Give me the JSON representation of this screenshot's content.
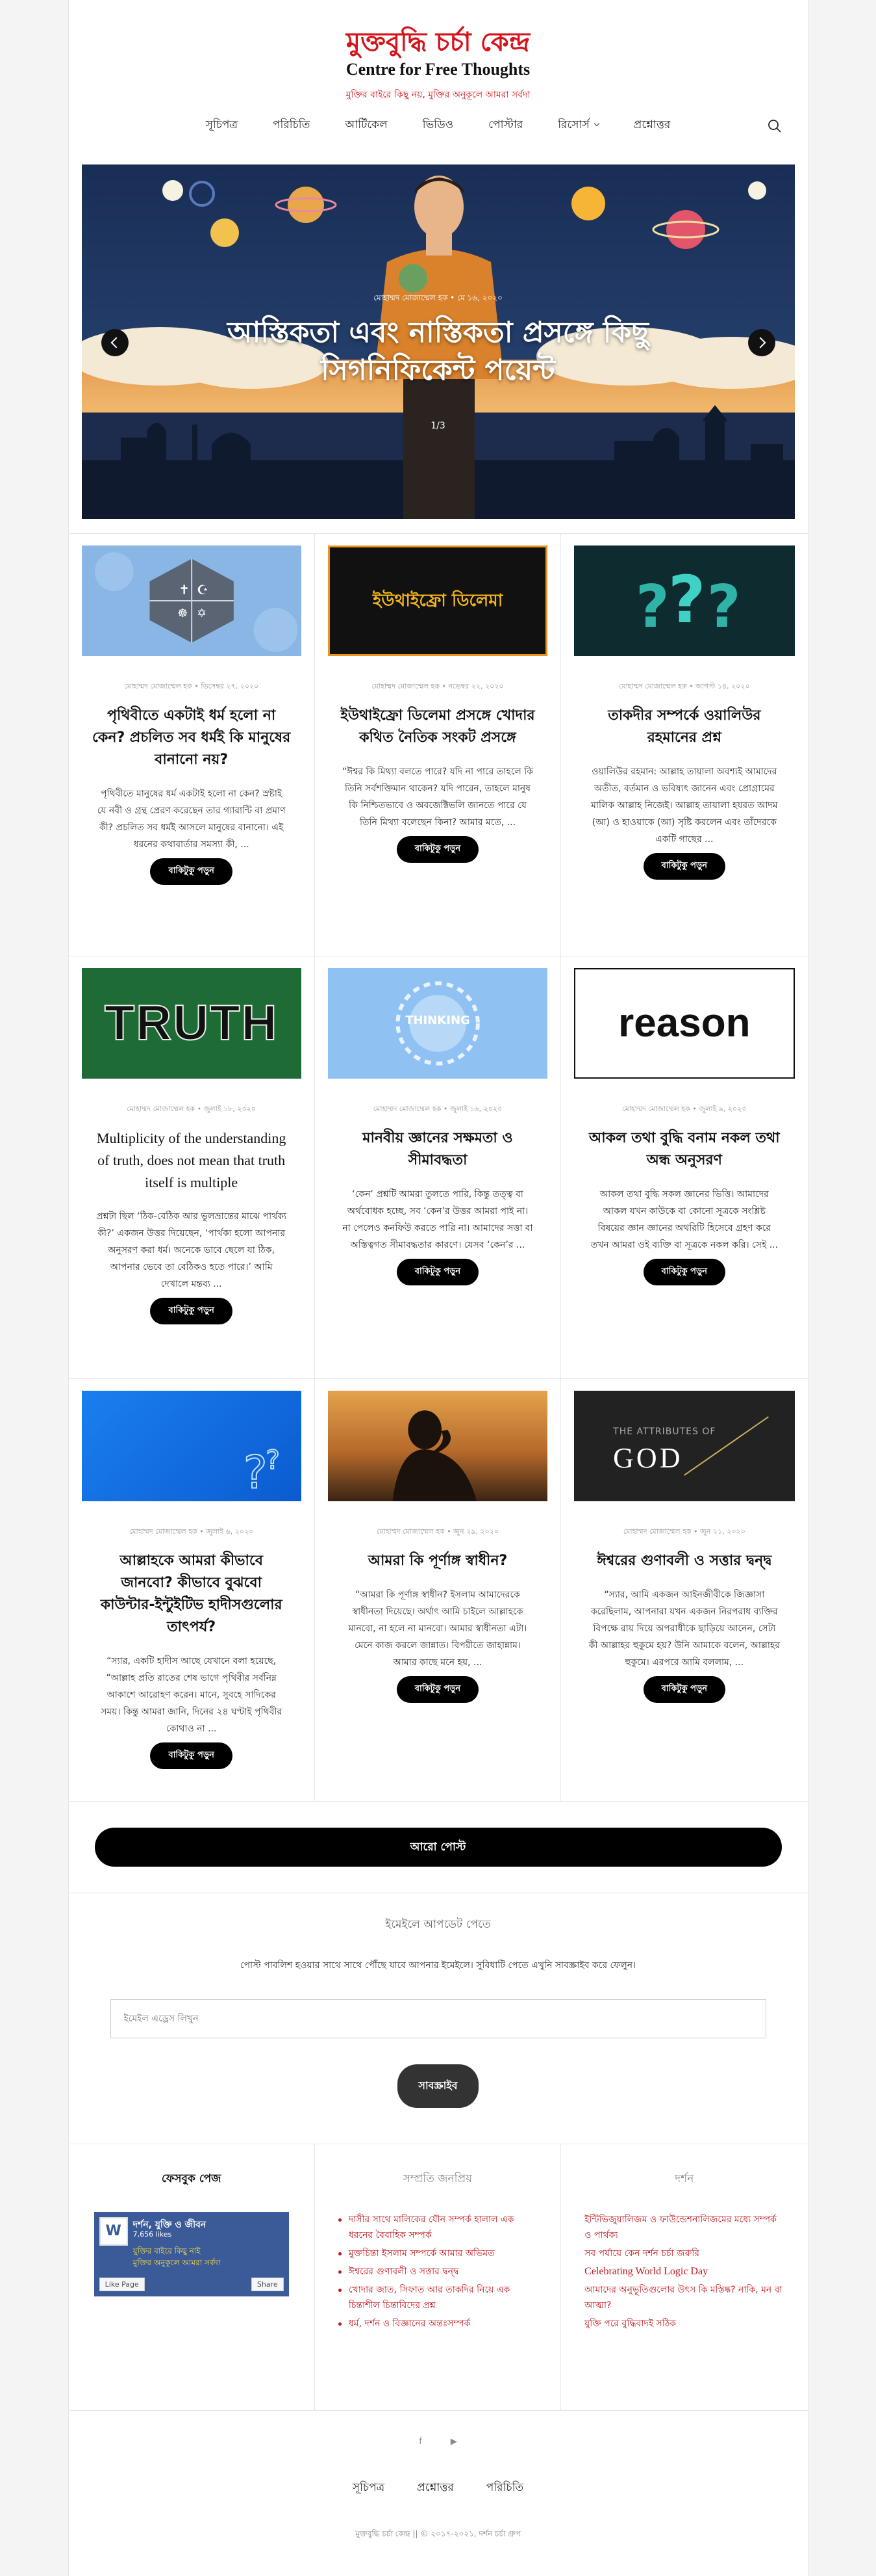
{
  "site": {
    "logo_bn": "মুক্তবুদ্ধি চর্চা কেন্দ্র",
    "logo_en": "Centre for Free Thoughts",
    "tagline": "মুক্তির বাইরে কিছু নয়, মুক্তির অনুকূলে আমরা সর্বদা"
  },
  "nav": [
    "সূচিপত্র",
    "পরিচিতি",
    "আর্টিকেল",
    "ভিডিও",
    "পোস্টার",
    "রিসোর্স",
    "প্রশ্নোত্তর"
  ],
  "slider": {
    "meta": "মোহাম্মদ মোজাম্মেল হক • মে ১৬, ২০২০",
    "title": "আস্তিকতা এবং নাস্তিকতা প্রসঙ্গে কিছু সিগনিফিকেন্ট পয়েন্ট",
    "count": "1/3"
  },
  "read_more": "বাকিটুকু পড়ুন",
  "posts": [
    {
      "meta": "মোহাম্মদ মোজাম্মেল হক • ডিসেম্বর ২৭, ২০২০",
      "title": "পৃথিবীতে একটাই ধর্ম হলো না কেন? প্রচলিত সব ধর্মই কি মানুষের বানানো নয়?",
      "excerpt": "পৃথিবীতে মানুষের ধর্ম একটাই হলো না কেন? স্রষ্টাই যে নবী ও গ্রন্থ প্রেরণ করেছেন তার গ্যারান্টি বা প্রমাণ কী? প্রচলিত সব ধর্মই আসলে মানুষের বানানো। এই ধরনের কথাবার্তার সমস্যা কী, ...",
      "thumb": "religions"
    },
    {
      "meta": "মোহাম্মদ মোজাম্মেল হক • নভেম্বর ২২, ২০২০",
      "title": "ইউথাইফ্রো ডিলেমা প্রসঙ্গে খোদার কথিত নৈতিক সংকট প্রসঙ্গে",
      "excerpt": "“ঈশ্বর কি মিথ্যা বলতে পারে? যদি না পারে তাহলে কি তিনি সর্বশক্তিমান থাকেন? যদি পারেন, তাহলে মানুষ কি নিশ্চিতভাবে ও অবজেক্টিভলি জানতে পারে যে তিনি মিথ্যা বলেছেন কিনা? আমার মতে, ...",
      "thumb": "dilemma",
      "thumb_text": "ইউথাইফ্রো ডিলেমা"
    },
    {
      "meta": "মোহাম্মদ মোজাম্মেল হক • আগস্ট ১৪, ২০২০",
      "title": "তাকদীর সম্পর্কে ওয়ালিউর রহমানের প্রশ্ন",
      "excerpt": "ওয়ালিউর রহমান: আল্লাহ তায়ালা অবশ্যই আমাদের অতীত, বর্তমান ও ভবিষ্যৎ জানেন এবং প্রোগ্রামের মালিক আল্লাহ নিজেই। আল্লাহ তায়ালা হযরত আদম (আ) ও হাওয়াকে (আ) সৃষ্টি করলেন এবং তাঁদেরকে একটি গাছের ...",
      "thumb": "question"
    },
    {
      "meta": "মোহাম্মদ মোজাম্মেল হক • জুলাই ১৮, ২০২০",
      "title": "Multiplicity of the understanding of truth, does not mean that truth itself is multiple",
      "excerpt": "প্রশ্নটা ছিল ‘ঠিক-বেঠিক আর ভুলভ্রান্তের মাঝে পার্থক্য কী?’ একজন উত্তর দিয়েছেন, ‘পার্থক্য হলো আপনার অনুসরণ করা ধর্ম। অনেকে ভাবে ছেলে যা ঠিক, আপনার ভেবে তা বেঠিকও হতে পারে।’ আমি দেখালে মন্তব্য ...",
      "thumb": "truth",
      "thumb_text": "TRUTH"
    },
    {
      "meta": "মোহাম্মদ মোজাম্মেল হক • জুলাই ১৬, ২০২০",
      "title": "মানবীয় জ্ঞানের সক্ষমতা ও সীমাবদ্ধতা",
      "excerpt": "‘কেন’ প্রশ্নটি আমরা তুলতে পারি, কিন্তু তত্ত্ব বা অর্থবোধক হচ্ছে, সব ‘কেন’র উত্তর আমরা পাই না। না পেলেও কনফিউ করতে পারি না। আমাদের সত্তা বা অস্তিত্বগত সীমাবদ্ধতার কারণে। যেসব ‘কেন’র ...",
      "thumb": "thinking",
      "thumb_text": "THINKING"
    },
    {
      "meta": "মোহাম্মদ মোজাম্মেল হক • জুলাই ৯, ২০২০",
      "title": "আকল তথা বুদ্ধি বনাম নকল তথা অন্ধ অনুসরণ",
      "excerpt": "আকল তথা বুদ্ধি সকল জ্ঞানের ভিত্তি। আমাদের আকল যখন কাউকে বা কোনো সূত্রকে সংশ্লিষ্ট বিষয়ের জ্ঞান জ্ঞানের অথরিটি হিসেবে গ্রহণ করে তখন আমরা ওই ব্যক্তি বা সূত্রকে নকল করি। সেই ...",
      "thumb": "reason",
      "thumb_text": "reason"
    },
    {
      "meta": "মোহাম্মদ মোজাম্মেল হক • জুলাই ৬, ২০২০",
      "title": "আল্লাহকে আমরা কীভাবে জানবো? কীভাবে বুঝবো কাউন্টার-ইন্টুইটিভ হাদীসগুলোর তাৎপর্য?",
      "excerpt": "“স্যার, একটি হাদীস আছে যেখানে বলা হয়েছে, “আল্লাহ প্রতি রাতের শেষ ভাগে পৃথিবীর সর্বনিম্ন আকাশে আরোহণ করেন। মানে, সুবহে সাদিকের সময়। কিন্তু আমরা জানি, দিনের ২৪ ঘণ্টাই পৃথিবীর কোথাও না ...",
      "thumb": "blueq"
    },
    {
      "meta": "মোহাম্মদ মোজাম্মেল হক • জুন ২৯, ২০২০",
      "title": "আমরা কি পূর্ণাঙ্গ স্বাধীন?",
      "excerpt": "“আমরা কি পূর্ণাঙ্গ স্বাধীন? ইসলাম আমাদেরকে স্বাধীনতা দিয়েছে। অর্থাৎ আমি চাইলে আল্লাহকে মানবো, না হলে না মানবো। আমার স্বাধীনতা এটা। মেনে কাজ করলে জান্নাত। বিপরীতে জাহান্নাম। আমার কাছে মনে হয়, ...",
      "thumb": "sunset"
    },
    {
      "meta": "মোহাম্মদ মোজাম্মেল হক • জুন ২১, ২০২০",
      "title": "ঈশ্বরের গুণাবলী ও সত্তার দ্বন্দ্ব",
      "excerpt": "“স্যার, আমি একজন আইনজীবীকে জিজ্ঞাসা করেছিলাম, আপনারা যখন একজন নিরপরাধ ব্যক্তির বিপক্ষে রায় দিয়ে অপরাধীকে ছাড়িয়ে আনেন, সেটা কী আল্লাহর হুকুমে হয়? উনি আমাকে বলেন, আল্লাহর হুকুমে। এরপরে আমি বললাম, ...",
      "thumb": "god",
      "thumb_text_small": "THE ATTRIBUTES OF",
      "thumb_text": "GOD"
    }
  ],
  "more_posts": "আরো পোস্ট",
  "subscribe": {
    "heading": "ইমেইলে আপডেট পেতে",
    "text": "পোস্ট পাবলিশ হওয়ার সাথে সাথে পৌঁছে যাবে আপনার ইমেইলে। সুবিধাটি পেতে এখুনি সাবস্ক্রাইব করে ফেলুন।",
    "placeholder": "ইমেইল এড্রেস লিখুন",
    "button": "সাবস্ক্রাইব"
  },
  "widgets": {
    "facebook": {
      "heading": "ফেসবুক পেজ",
      "page_name": "দর্শন, যুক্তি ও জীবন",
      "likes": "7,656 likes",
      "cover_text_1": "যুক্তির বাইরে কিছু নাই",
      "cover_text_2": "মুক্তির অনুকূলে আমরা সর্বদা",
      "like_btn": "Like Page",
      "share_btn": "Share"
    },
    "popular": {
      "heading": "সম্প্রতি জনপ্রিয়",
      "items": [
        "দাসীর সাথে মালিকের যৌন সম্পর্ক হালাল এক ধরনের বৈবাহিক সম্পর্ক",
        "মুক্তচিন্তা ইসলাম সম্পর্কে আমার অভিমত",
        "ঈশ্বরের গুণাবলী ও সত্তার দ্বন্দ্ব",
        "খোদার জাত, সিফাত আর তাকদির নিয়ে এক চিন্তাশীল চিন্তাবিদের প্রশ্ন",
        "ধর্ম, দর্শন ও বিজ্ঞানের অন্তঃসম্পর্ক"
      ]
    },
    "philosophy": {
      "heading": "দর্শন",
      "items": [
        "ইন্টিভিজুয়ালিজম ও ফাউন্ডেশনালিজমের মধ্যে সম্পর্ক ও পার্থক্য",
        "সব পর্যায়ে কেন দর্শন চর্চা জরুরি",
        "Celebrating World Logic Day",
        "আমাদের অনুভূতিগুলোর উৎস কি মস্তিষ্ক? নাকি, মন বা আত্মা?",
        "যুক্তি পরে বুদ্ধিবাদই সঠিক"
      ]
    }
  },
  "footer": {
    "social": [
      "f",
      "▶"
    ],
    "menu": [
      "সূচিপত্র",
      "প্রশ্নোত্তর",
      "পরিচিতি"
    ],
    "copyright": "মুক্তবুদ্ধি চর্চা কেন্দ্র || © ২০১৭-২০২১, দর্শন চর্চা গ্রুপ"
  },
  "colors": {
    "accent": "#d4141b",
    "dark": "#000000"
  }
}
